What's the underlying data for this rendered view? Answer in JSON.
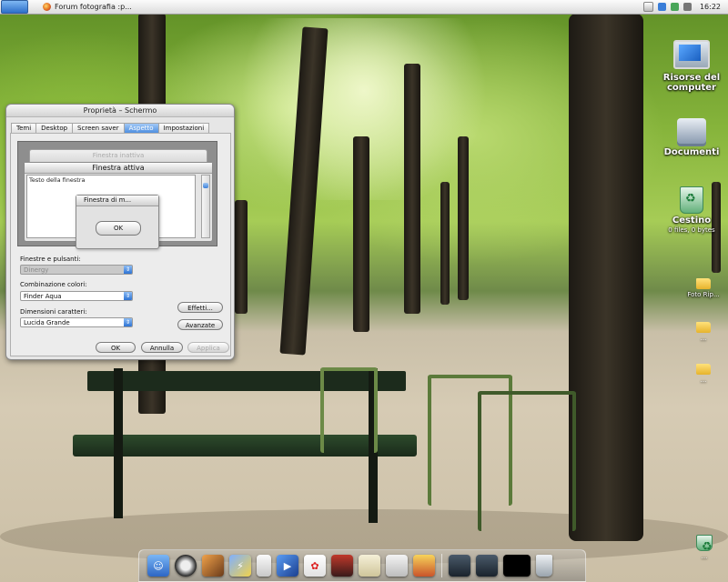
{
  "taskbar": {
    "task_label": "Forum fotografia :p...",
    "clock": "16:22"
  },
  "desktop_icons": {
    "computer": "Risorse del computer",
    "documents": "Documenti",
    "trash": "Cestino",
    "trash_info": "0 files, 0 bytes",
    "folder1": "Foto Rip...",
    "folder2": "...",
    "folder3": "...",
    "bottom_trash": "..."
  },
  "dialog": {
    "title": "Proprietà – Schermo",
    "tabs": [
      "Temi",
      "Desktop",
      "Screen saver",
      "Aspetto",
      "Impostazioni"
    ],
    "active_tab": "Aspetto",
    "preview": {
      "inactive_window": "Finestra inattiva",
      "active_window": "Finestra attiva",
      "window_text": "Testo della finestra",
      "message_box": "Finestra di m...",
      "ok": "OK"
    },
    "windows_buttons_label": "Finestre e pulsanti:",
    "windows_buttons_value": "Dinergy",
    "color_scheme_label": "Combinazione colori:",
    "color_scheme_value": "Finder Aqua",
    "font_size_label": "Dimensioni caratteri:",
    "font_size_value": "Lucida Grande",
    "effects_button": "Effetti...",
    "advanced_button": "Avanzate",
    "ok_button": "OK",
    "cancel_button": "Annulla",
    "apply_button": "Applica"
  },
  "colors": {
    "accent": "#4f8fe0",
    "title_bar": "#d4d4d4"
  },
  "dock": {
    "icons": [
      "finder-icon",
      "browser-icon",
      "photo-icon",
      "lightning-icon",
      "ipod-icon",
      "clapper-icon",
      "chat-icon",
      "character-icon",
      "bone-icon",
      "apple-icon",
      "city-icon",
      "drive-icon",
      "drive2-icon",
      "terminal-icon",
      "trash-icon"
    ]
  }
}
